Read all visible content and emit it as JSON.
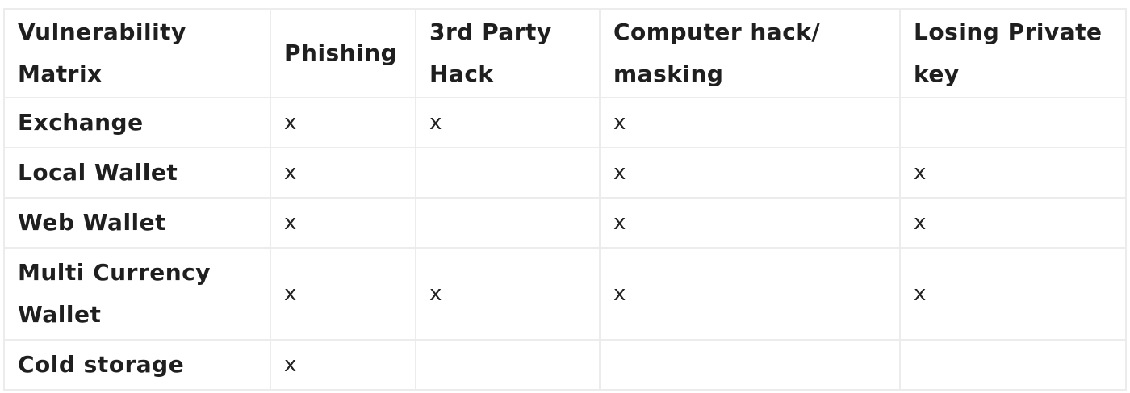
{
  "table": {
    "headers": [
      "Vulnerability Matrix",
      "Phishing",
      "3rd Party Hack",
      "Computer hack/ masking",
      "Losing Private key"
    ],
    "rows": [
      {
        "label": "Exchange",
        "cells": [
          "x",
          "x",
          "x",
          ""
        ]
      },
      {
        "label": "Local Wallet",
        "cells": [
          "x",
          "",
          "x",
          "x"
        ]
      },
      {
        "label": "Web Wallet",
        "cells": [
          "x",
          "",
          "x",
          "x"
        ]
      },
      {
        "label": "Multi Currency Wallet",
        "cells": [
          "x",
          "x",
          "x",
          "x"
        ]
      },
      {
        "label": "Cold storage",
        "cells": [
          "x",
          "",
          "",
          ""
        ]
      }
    ]
  }
}
